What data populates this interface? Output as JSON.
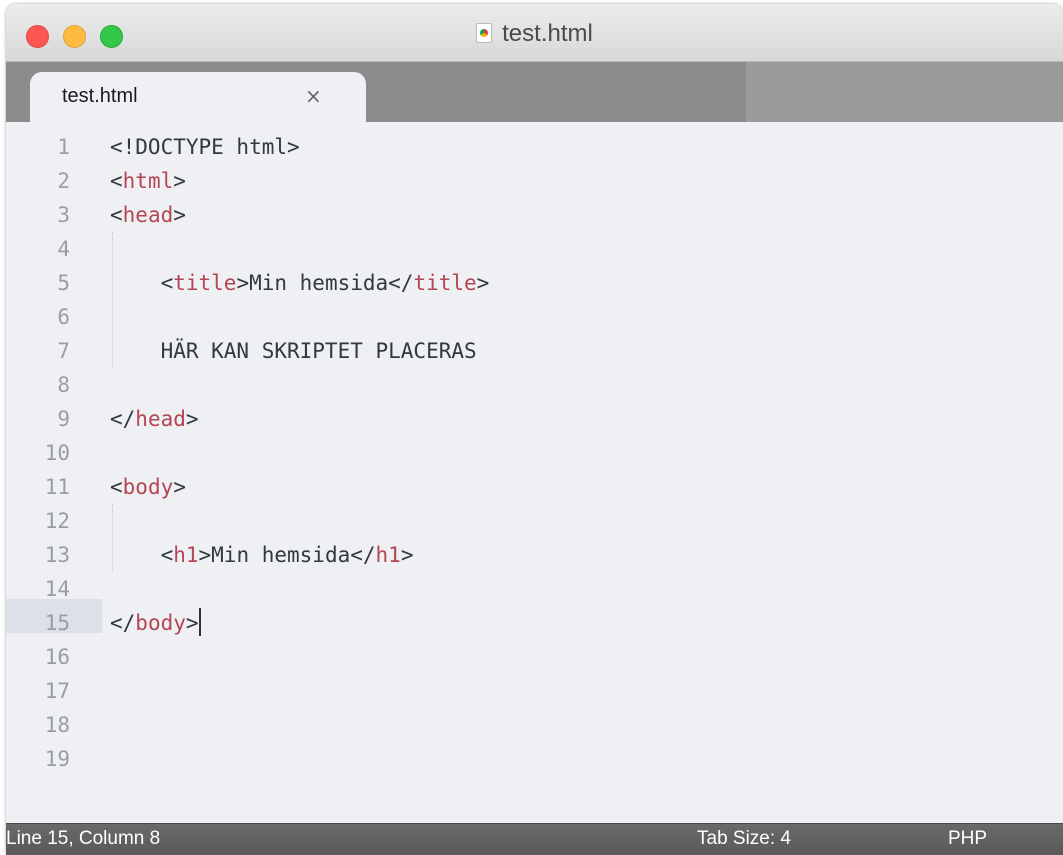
{
  "window": {
    "title": "test.html",
    "file_icon": "chrome-html-file-icon"
  },
  "tab": {
    "label": "test.html",
    "close_glyph": "×"
  },
  "editor": {
    "line_numbers": [
      "1",
      "2",
      "3",
      "4",
      "5",
      "6",
      "7",
      "8",
      "9",
      "10",
      "11",
      "12",
      "13",
      "14",
      "15",
      "16",
      "17",
      "18",
      "19"
    ],
    "current_line": 15,
    "lines": [
      {
        "segments": [
          {
            "t": "<!DOCTYPE html>",
            "k": "text"
          }
        ]
      },
      {
        "segments": [
          {
            "t": "<",
            "k": "text"
          },
          {
            "t": "html",
            "k": "tag"
          },
          {
            "t": ">",
            "k": "text"
          }
        ]
      },
      {
        "segments": [
          {
            "t": "<",
            "k": "text"
          },
          {
            "t": "head",
            "k": "tag"
          },
          {
            "t": ">",
            "k": "text"
          }
        ]
      },
      {
        "segments": []
      },
      {
        "segments": [
          {
            "t": "    <",
            "k": "text"
          },
          {
            "t": "title",
            "k": "tag"
          },
          {
            "t": ">Min hemsida</",
            "k": "text"
          },
          {
            "t": "title",
            "k": "tag"
          },
          {
            "t": ">",
            "k": "text"
          }
        ]
      },
      {
        "segments": []
      },
      {
        "segments": [
          {
            "t": "    HÄR KAN SKRIPTET PLACERAS",
            "k": "text"
          }
        ]
      },
      {
        "segments": []
      },
      {
        "segments": [
          {
            "t": "</",
            "k": "text"
          },
          {
            "t": "head",
            "k": "tag"
          },
          {
            "t": ">",
            "k": "text"
          }
        ]
      },
      {
        "segments": []
      },
      {
        "segments": [
          {
            "t": "<",
            "k": "text"
          },
          {
            "t": "body",
            "k": "tag"
          },
          {
            "t": ">",
            "k": "text"
          }
        ]
      },
      {
        "segments": []
      },
      {
        "segments": [
          {
            "t": "    <",
            "k": "text"
          },
          {
            "t": "h1",
            "k": "tag"
          },
          {
            "t": ">Min hemsida</",
            "k": "text"
          },
          {
            "t": "h1",
            "k": "tag"
          },
          {
            "t": ">",
            "k": "text"
          }
        ]
      },
      {
        "segments": []
      },
      {
        "segments": [
          {
            "t": "</",
            "k": "text"
          },
          {
            "t": "body",
            "k": "tag"
          },
          {
            "t": ">",
            "k": "text"
          }
        ],
        "cursor": true
      },
      {
        "segments": []
      },
      {
        "segments": []
      },
      {
        "segments": []
      },
      {
        "segments": []
      }
    ]
  },
  "status": {
    "position": "Line 15, Column 8",
    "tab_size": "Tab Size: 4",
    "syntax": "PHP"
  },
  "colors": {
    "tag": "#b64554",
    "text": "#333840",
    "line_number": "#9a9da3",
    "editor_bg": "#eef0f4",
    "status_bg": "#5f5f5f"
  }
}
